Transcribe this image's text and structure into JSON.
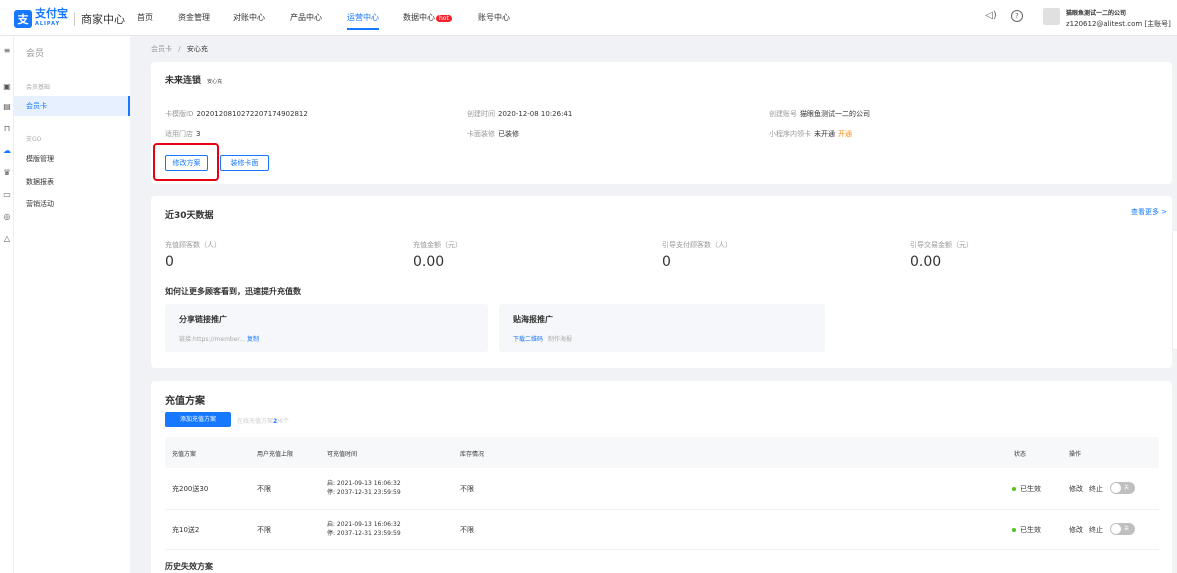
{
  "nav": {
    "logo_glyph": "支",
    "logo_text": "支付宝",
    "logo_sub": "ALIPAY",
    "logo_title": "商家中心",
    "items": [
      {
        "label": "首页"
      },
      {
        "label": "资金管理"
      },
      {
        "label": "对账中心"
      },
      {
        "label": "产品中心"
      },
      {
        "label": "运营中心",
        "active": true
      },
      {
        "label": "数据中心",
        "badge": "hot"
      },
      {
        "label": "账号中心"
      }
    ],
    "account_company": "猫眼鱼测试一二的公司",
    "account_email": "z120612@alitest.com [主账号]"
  },
  "iconbar": {
    "icons": [
      "menu-icon",
      "shop-icon",
      "doc-icon",
      "cart-icon",
      "cloud-icon",
      "crown-icon",
      "card-icon",
      "medal-icon",
      "bell-icon"
    ]
  },
  "sidebar": {
    "title": "会员",
    "group1": "会员基础",
    "item_card": "会员卡",
    "group2": "支GO",
    "item_templates": "模版管理",
    "item_reports": "数据报表",
    "item_marketing": "营销活动"
  },
  "breadcrumb": {
    "parent": "会员卡",
    "sep": "/",
    "current": "安心充"
  },
  "info": {
    "title": "未来连锁",
    "tag": "安心充",
    "template_id_label": "卡模版ID",
    "template_id": "20201208102722071749​02812",
    "created_label": "创建时间",
    "created": "2020-12-08 10:26:41",
    "creator_label": "创建账号",
    "creator": "猫眼鱼测试一二的公司",
    "stores_label": "适用门店",
    "stores": "3",
    "decor_label": "卡面装修",
    "decor": "已装修",
    "mini_label": "小程序内领卡",
    "mini": "未开通",
    "mini_action": "开通",
    "btn_modify": "修改方案",
    "btn_decorate": "装修卡面"
  },
  "stats": {
    "title": "近30天数据",
    "more": "查看更多 >",
    "items": [
      {
        "label": "充值顾客数（人）",
        "value": "0"
      },
      {
        "label": "充值金额（元）",
        "value": "0.00"
      },
      {
        "label": "引导支付顾客数（人）",
        "value": "0"
      },
      {
        "label": "引导交易金额（元）",
        "value": "0.00"
      }
    ],
    "promo_heading": "如何让更多顾客看到，迅速提升充值数",
    "promo1_title": "分享链接推广",
    "promo1_desc": "链接:https://member...",
    "promo1_action": "复制",
    "promo2_title": "贴海报推广",
    "promo2_action1": "下载二维码",
    "promo2_action2": "制作海报"
  },
  "plans": {
    "title": "充值方案",
    "add_button": "添加充值方案",
    "online_label": "在线充值方案",
    "online_count": "2",
    "online_total": "/6个",
    "columns": [
      "充值方案",
      "用户充值上限",
      "可充值时间",
      "库存情况",
      "状态",
      "操作"
    ],
    "rows": [
      {
        "name": "充200送30",
        "limit": "不限",
        "start": "启: 2021-09-13 16:06:32",
        "end": "停: 2037-12-31 23:59:59",
        "stock": "不限",
        "status": "已生效",
        "edit": "修改",
        "stop": "终止",
        "toggle": "关"
      },
      {
        "name": "充10送2",
        "limit": "不限",
        "start": "启: 2021-09-13 16:06:32",
        "end": "停: 2037-12-31 23:59:59",
        "stock": "不限",
        "status": "已生效",
        "edit": "修改",
        "stop": "终止",
        "toggle": "关"
      }
    ],
    "history_title": "历史失效方案"
  }
}
